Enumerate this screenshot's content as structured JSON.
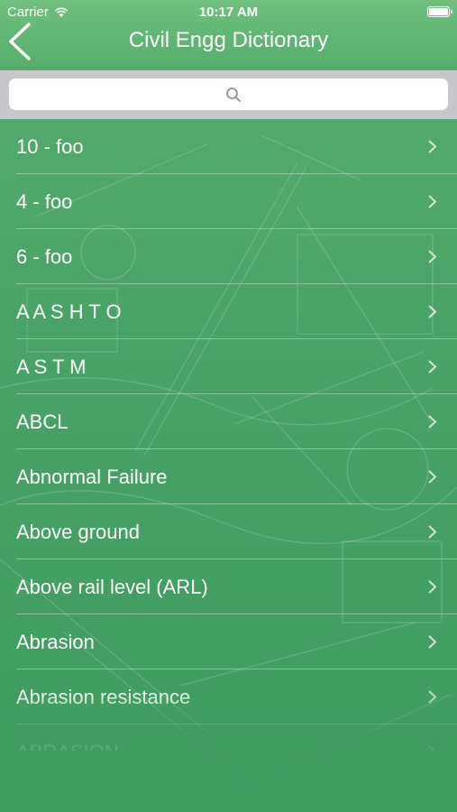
{
  "status_bar": {
    "carrier": "Carrier",
    "time": "10:17 AM"
  },
  "nav": {
    "title": "Civil Engg Dictionary",
    "back_icon": "chevron-left-icon"
  },
  "search": {
    "placeholder": "",
    "value": ""
  },
  "list": {
    "items": [
      {
        "label": "10 - foo"
      },
      {
        "label": "4 - foo"
      },
      {
        "label": "6 - foo"
      },
      {
        "label": "A A S H T O"
      },
      {
        "label": "A S T M"
      },
      {
        "label": "ABCL"
      },
      {
        "label": "Abnormal Failure"
      },
      {
        "label": "Above ground"
      },
      {
        "label": "Above rail level (ARL)"
      },
      {
        "label": "Abrasion"
      },
      {
        "label": "Abrasion resistance"
      },
      {
        "label": "ABRASION"
      }
    ]
  },
  "colors": {
    "nav": "#5fb372",
    "background": "#4aa366",
    "search_bar": "#c8c8cc"
  }
}
